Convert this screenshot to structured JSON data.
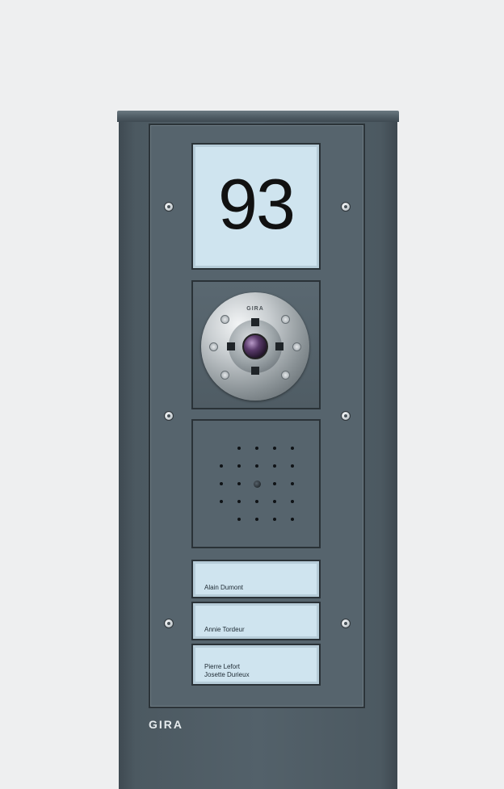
{
  "panel": {
    "house_number": "93",
    "camera_brand": "GIRA",
    "brand": "GIRA"
  },
  "nameplates": [
    {
      "line1": "Alain Dumont",
      "line2": ""
    },
    {
      "line1": "Annie Tordeur",
      "line2": ""
    },
    {
      "line1": "Pierre Lefort",
      "line2": "Josette Durieux"
    }
  ],
  "colors": {
    "background": "#eeeff0",
    "panel": "#53616a",
    "label": "#cfe4ef"
  }
}
